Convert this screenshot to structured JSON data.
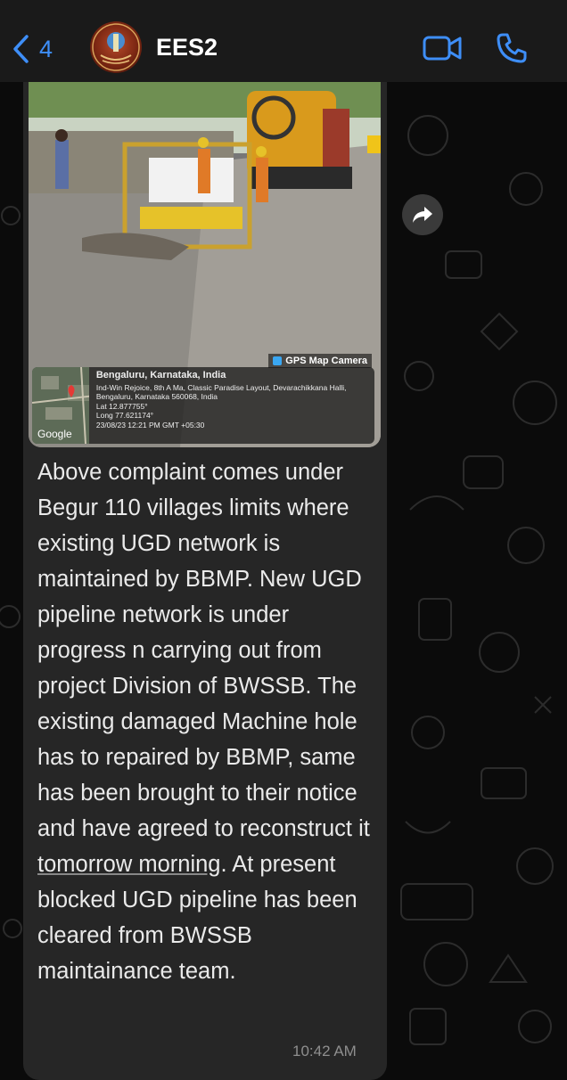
{
  "header": {
    "back_count": "4",
    "title": "EES2",
    "back_icon": "chevron-left-icon",
    "video_icon": "video-camera-icon",
    "call_icon": "phone-icon",
    "accent": "#3e8ef7"
  },
  "message": {
    "photo": {
      "gps_tag": "GPS Map Camera",
      "city": "Bengaluru, Karnataka, India",
      "address": "Ind-Win Rejoice, 8th A Ma, Classic Paradise Layout, Devarachikkana Halli, Bengaluru, Karnataka 560068, India",
      "lat": "Lat 12.877755°",
      "long": "Long 77.621174°",
      "datetime": "23/08/23 12:21 PM GMT +05:30",
      "map_brand": "Google"
    },
    "text_before_link": "Above complaint comes under Begur 110 villages limits where existing UGD network is maintained by BBMP. New UGD pipeline network is under progress n carrying out from project Division of BWSSB. The existing damaged Machine hole has to repaired by BBMP, same has been brought to their notice and have agreed to reconstruct it ",
    "link_text": "tomorrow morning",
    "text_after_link": ". At present blocked UGD pipeline has been cleared from BWSSB maintainance team.",
    "time": "10:42 AM"
  },
  "actions": {
    "forward_icon": "forward-arrow-icon"
  }
}
